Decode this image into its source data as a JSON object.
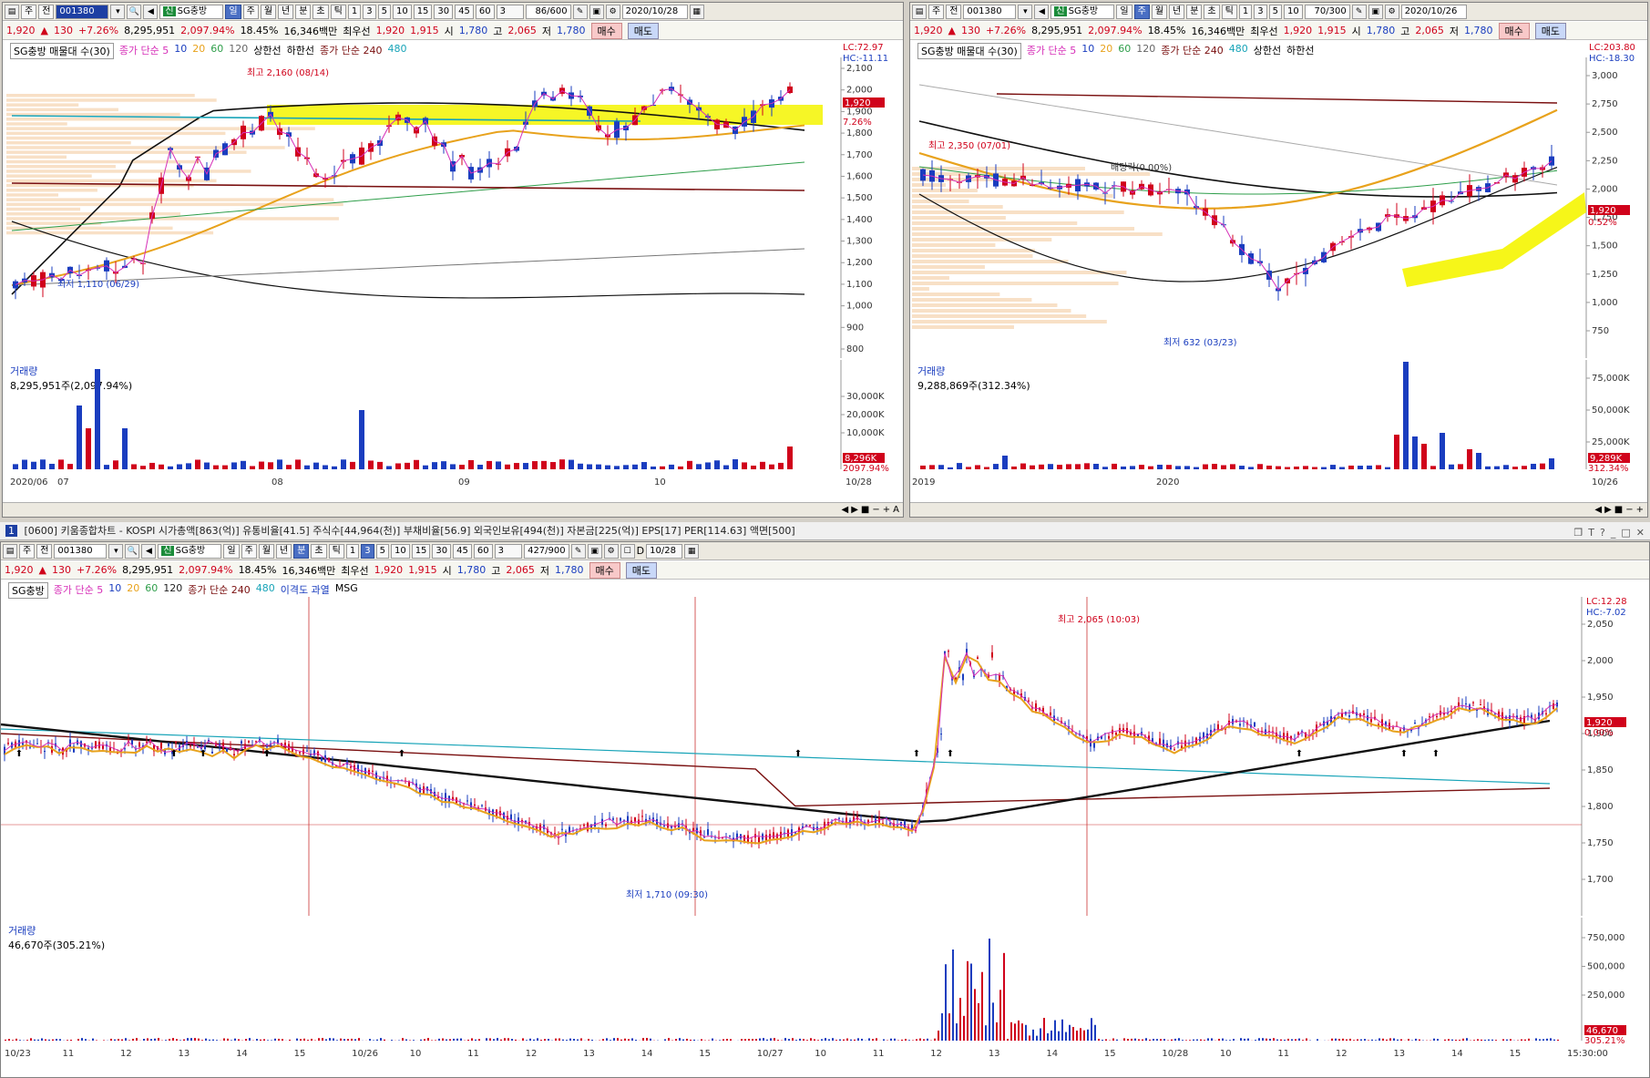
{
  "common": {
    "type_select": "주",
    "prev_label": "전",
    "code": "001380",
    "stock_name": "SG충방",
    "stock_tag": "신",
    "quote": {
      "price": "1,920",
      "change": "130",
      "change_pct": "+7.26%",
      "volume": "8,295,951",
      "volume_pct": "2,097.94%",
      "turnover": "18.45%",
      "amount": "16,346백만",
      "best_label": "최우선",
      "best_ask": "1,920",
      "best_bid": "1,915",
      "open_label": "시",
      "open": "1,780",
      "high_label": "고",
      "high": "2,065",
      "low_label": "저",
      "low": "1,780",
      "buy_label": "매수",
      "sell_label": "매도"
    },
    "period_buttons": [
      "일",
      "주",
      "월",
      "년",
      "분",
      "초",
      "틱"
    ],
    "interval_buttons": [
      "1",
      "3",
      "5",
      "10",
      "15",
      "30",
      "45",
      "60"
    ],
    "interval_select": "3"
  },
  "panel_daily": {
    "count": "86/600",
    "date": "2020/10/28",
    "legend": [
      "SG충방 매물대 수(30)",
      "종가 단순 5",
      "10",
      "20",
      "60",
      "120",
      "상한선",
      "하한선",
      "종가 단순 240",
      "480"
    ],
    "lc": "LC:72.97",
    "hc": "HC:-11.11",
    "price_ticks": [
      "2,100",
      "2,000",
      "1,900",
      "1,800",
      "1,700",
      "1,600",
      "1,500",
      "1,400",
      "1,300",
      "1,200",
      "1,100",
      "1,000",
      "900",
      "800"
    ],
    "current_price_tag": "1,920",
    "current_pct_tag": "7.26%",
    "annot_high": "최고 2,160 (08/14)",
    "annot_low": "최저 1,110 (06/29)",
    "volume_title": "거래량",
    "volume_value": "8,295,951주(2,097.94%)",
    "vol_ticks": [
      "30,000K",
      "20,000K",
      "10,000K"
    ],
    "vol_tag": "8,296K",
    "vol_pct_tag": "2097.94%",
    "x_labels": [
      "2020/06",
      "07",
      "08",
      "09",
      "10",
      "10/28"
    ]
  },
  "panel_weekly": {
    "count": "70/300",
    "date": "2020/10/26",
    "legend": [
      "SG충방 매물대 수(30)",
      "종가 단순 5",
      "10",
      "20",
      "60",
      "120",
      "종가 단순 240",
      "480",
      "상한선",
      "하한선"
    ],
    "lc": "LC:203.80",
    "hc": "HC:-18.30",
    "price_ticks": [
      "3,000",
      "2,750",
      "2,500",
      "2,250",
      "2,000",
      "1,750",
      "1,500",
      "1,250",
      "1,000",
      "750"
    ],
    "current_price_tag": "1,920",
    "current_pct_tag": "0.52%",
    "annot_high": "최고 2,350 (07/01)",
    "annot_low": "최저 632 (03/23)",
    "annot_mid": "배당락(0.00%)",
    "volume_title": "거래량",
    "volume_value": "9,288,869주(312.34%)",
    "vol_ticks": [
      "75,000K",
      "50,000K",
      "25,000K"
    ],
    "vol_tag": "9,289K",
    "vol_pct_tag": "312.34%",
    "x_labels": [
      "2019",
      "2020",
      "10/26"
    ]
  },
  "title_strip": {
    "num": "1",
    "text": "[0600] 키움종합차트 - KOSPI 시가총액[863(억)] 유통비율[41.5] 주식수[44,964(천)] 부채비율[56.9] 외국인보유[494(천)] 자본금[225(억)] EPS[17] PER[114.63] 액면[500]"
  },
  "panel_minute": {
    "count": "427/900",
    "d_label": "D",
    "date": "10/28",
    "legend": [
      "SG충방",
      "종가 단순 5",
      "10",
      "20",
      "60",
      "120",
      "종가 단순 240",
      "480",
      "이격도 과열",
      "MSG"
    ],
    "lc": "LC:12.28",
    "hc": "HC:-7.02",
    "price_ticks": [
      "2,050",
      "2,000",
      "1,950",
      "1,900",
      "1,850",
      "1,800",
      "1,750",
      "1,700"
    ],
    "current_price_tag": "1,920",
    "current_pct_tag": "0.00%",
    "annot_high": "최고 2,065 (10:03)",
    "annot_low": "최저 1,710 (09:30)",
    "volume_title": "거래량",
    "volume_value": "46,670주(305.21%)",
    "vol_ticks": [
      "750,000",
      "500,000",
      "250,000"
    ],
    "vol_tag": "46,670",
    "vol_pct_tag": "305.21%",
    "x_labels": [
      "10/23",
      "11",
      "12",
      "13",
      "14",
      "15",
      "10/26",
      "10",
      "11",
      "12",
      "13",
      "14",
      "15",
      "10/27",
      "10",
      "11",
      "12",
      "13",
      "14",
      "15",
      "10/28",
      "10",
      "11",
      "12",
      "13",
      "14",
      "15",
      "15:30:00"
    ]
  },
  "colors": {
    "up": "#d0021b",
    "down": "#1a3dbf",
    "ma5": "#d62fb8",
    "ma20": "#e8a21c",
    "ma60": "#2e9e4a",
    "ma120": "#222222",
    "ma240": "#7a1010",
    "ma480": "#18a4b8",
    "highlight": "#f5f500"
  }
}
